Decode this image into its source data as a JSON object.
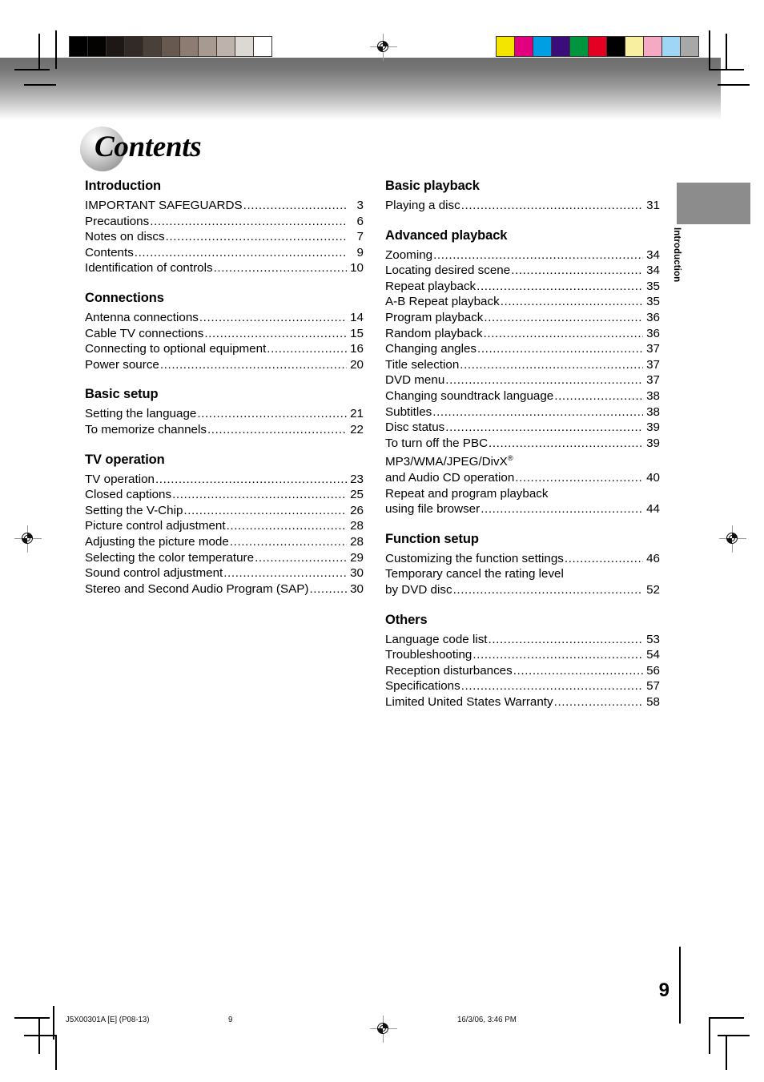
{
  "document": {
    "title": "Contents",
    "page_number": "9",
    "side_tab_label": "Introduction"
  },
  "footer": {
    "file_code": "J5X00301A [E] (P08-13)",
    "page": "9",
    "timestamp": "16/3/06, 3:46 PM"
  },
  "prepress": {
    "grayscale_wedge": [
      "#000000",
      "#050202",
      "#1d1816",
      "#322a26",
      "#4a403a",
      "#67594f",
      "#8c7c72",
      "#a69a91",
      "#bdb3ac",
      "#dcd8d3",
      "#ffffff"
    ],
    "color_bars": [
      "#f3e500",
      "#e3007f",
      "#009fe3",
      "#3a0d7a",
      "#009640",
      "#e30022",
      "#000000",
      "#f8f0a0",
      "#f5a9c4",
      "#9fd5f5",
      "#a8a8a8"
    ]
  },
  "columns": {
    "left": [
      {
        "heading": "Introduction",
        "entries": [
          {
            "label": "IMPORTANT SAFEGUARDS",
            "page": "3"
          },
          {
            "label": "Precautions",
            "page": "6"
          },
          {
            "label": "Notes on discs",
            "page": "7"
          },
          {
            "label": "Contents",
            "page": "9"
          },
          {
            "label": "Identification of controls",
            "page": "10"
          }
        ]
      },
      {
        "heading": "Connections",
        "entries": [
          {
            "label": "Antenna connections",
            "page": "14"
          },
          {
            "label": "Cable TV connections",
            "page": "15"
          },
          {
            "label": "Connecting to optional equipment",
            "page": "16"
          },
          {
            "label": "Power source",
            "page": "20"
          }
        ]
      },
      {
        "heading": "Basic setup",
        "entries": [
          {
            "label": "Setting the language",
            "page": "21"
          },
          {
            "label": "To memorize channels",
            "page": "22"
          }
        ]
      },
      {
        "heading": "TV operation",
        "entries": [
          {
            "label": "TV operation",
            "page": "23"
          },
          {
            "label": "Closed captions",
            "page": "25"
          },
          {
            "label": "Setting the V-Chip",
            "page": "26"
          },
          {
            "label": "Picture control adjustment",
            "page": "28"
          },
          {
            "label": "Adjusting the picture mode",
            "page": "28"
          },
          {
            "label": "Selecting the color temperature",
            "page": "29"
          },
          {
            "label": "Sound control adjustment",
            "page": "30"
          },
          {
            "label": "Stereo and Second Audio Program (SAP)",
            "page": "30"
          }
        ]
      }
    ],
    "right": [
      {
        "heading": "Basic playback",
        "entries": [
          {
            "label": "Playing a disc",
            "page": "31"
          }
        ]
      },
      {
        "heading": "Advanced playback",
        "entries": [
          {
            "label": "Zooming",
            "page": "34"
          },
          {
            "label": "Locating desired scene",
            "page": "34"
          },
          {
            "label": "Repeat playback",
            "page": "35"
          },
          {
            "label": "A-B Repeat playback",
            "page": "35"
          },
          {
            "label": "Program playback",
            "page": "36"
          },
          {
            "label": "Random playback",
            "page": "36"
          },
          {
            "label": "Changing angles",
            "page": "37"
          },
          {
            "label": "Title selection",
            "page": "37"
          },
          {
            "label": "DVD menu",
            "page": "37"
          },
          {
            "label": "Changing soundtrack language",
            "page": "38"
          },
          {
            "label": "Subtitles",
            "page": "38"
          },
          {
            "label": "Disc status",
            "page": "39"
          },
          {
            "label": "To turn off the PBC",
            "page": "39"
          },
          {
            "label": "MP3/WMA/JPEG/DivX®",
            "page": "",
            "continued": true
          },
          {
            "label": "and Audio CD operation",
            "page": "40"
          },
          {
            "label": "Repeat and program playback",
            "page": "",
            "continued": true
          },
          {
            "label": "using file browser",
            "page": "44"
          }
        ]
      },
      {
        "heading": "Function setup",
        "entries": [
          {
            "label": "Customizing the function settings",
            "page": "46"
          },
          {
            "label": "Temporary cancel the rating level",
            "page": "",
            "continued": true
          },
          {
            "label": "by DVD disc",
            "page": "52"
          }
        ]
      },
      {
        "heading": "Others",
        "entries": [
          {
            "label": "Language code list",
            "page": "53"
          },
          {
            "label": "Troubleshooting",
            "page": "54"
          },
          {
            "label": "Reception disturbances",
            "page": "56"
          },
          {
            "label": "Specifications",
            "page": "57"
          },
          {
            "label": "Limited United States Warranty",
            "page": "58"
          }
        ]
      }
    ]
  }
}
